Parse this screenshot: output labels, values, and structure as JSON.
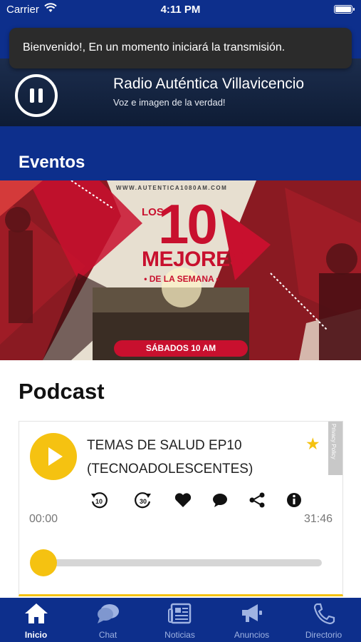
{
  "status_bar": {
    "carrier": "Carrier",
    "time": "4:11 PM"
  },
  "toast": {
    "message": "Bienvenido!, En un momento iniciará la transmisión."
  },
  "player": {
    "station_name": "Radio Auténtica Villavicencio",
    "tagline": "Voz e imagen de la verdad!"
  },
  "sections": {
    "eventos": "Eventos",
    "podcast": "Podcast"
  },
  "banner": {
    "url": "WWW.AUTENTICA1080AM.COM",
    "los": "LOS",
    "number": "10",
    "mejores": "MEJORES",
    "semana": "• DE LA SEMANA •",
    "schedule": "SÁBADOS 10 AM"
  },
  "podcast": {
    "title": "TEMAS DE SALUD EP10 (TECNOADOLESCENTES)",
    "privacy_label": "Privacy Policy",
    "time_current": "00:00",
    "time_total": "31:46",
    "progress": 0,
    "controls": [
      {
        "icon": "rewind-10-icon",
        "label": "10"
      },
      {
        "icon": "forward-30-icon",
        "label": "30"
      },
      {
        "icon": "heart-icon"
      },
      {
        "icon": "comment-icon"
      },
      {
        "icon": "share-icon"
      },
      {
        "icon": "info-icon"
      }
    ]
  },
  "tabs": [
    {
      "label": "Inicio",
      "icon": "home-icon",
      "active": true
    },
    {
      "label": "Chat",
      "icon": "chat-icon",
      "active": false
    },
    {
      "label": "Noticias",
      "icon": "newspaper-icon",
      "active": false
    },
    {
      "label": "Anuncios",
      "icon": "megaphone-icon",
      "active": false
    },
    {
      "label": "Directorio",
      "icon": "phone-icon",
      "active": false
    }
  ],
  "colors": {
    "brand_blue": "#0d2f8c",
    "accent_yellow": "#f5c211",
    "banner_red": "#c8102e"
  }
}
